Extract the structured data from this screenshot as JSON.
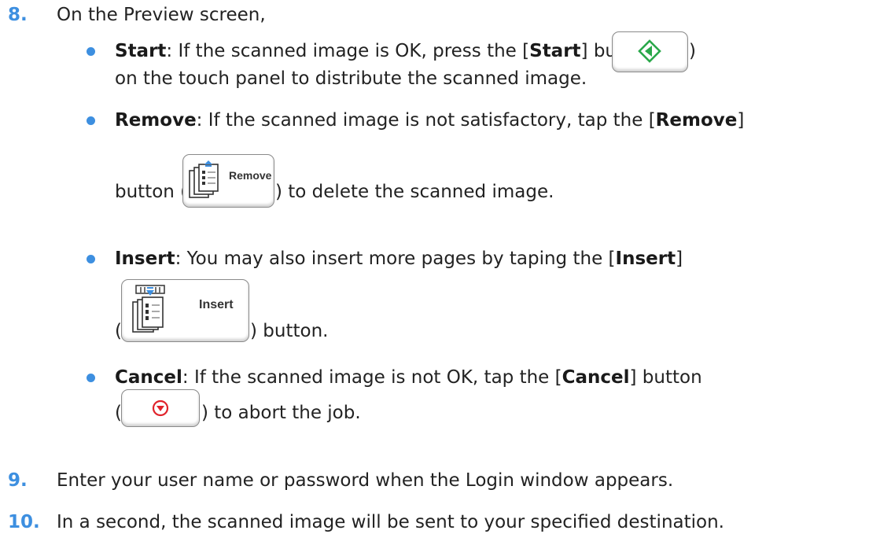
{
  "steps": [
    {
      "number": "8.",
      "text": "On the Preview screen,"
    },
    {
      "number": "9.",
      "text": "Enter your user name or password when the Login window appears."
    },
    {
      "number": "10.",
      "text": "In a second, the scanned image will be sent to your specified destination."
    }
  ],
  "bullets": {
    "start": {
      "term": "Start",
      "line1_a": ": If the scanned image is OK, press the [",
      "line1_b": "Start",
      "line1_c": "] button (",
      "line1_d": ")",
      "line2": "on the touch panel to distribute the scanned image."
    },
    "remove": {
      "term": "Remove",
      "line1_a": ": If the scanned image is not satisfactory, tap the [",
      "line1_b": "Remove",
      "line1_c": "]",
      "line2_a": "button (",
      "line2_b": ") to delete the scanned image.",
      "button_label": "Remove"
    },
    "insert": {
      "term": "Insert",
      "line1_a": ": You may also insert more pages by taping the [",
      "line1_b": "Insert",
      "line1_c": "]",
      "line2_a": "(",
      "line2_b": ") button.",
      "button_label": "Insert"
    },
    "cancel": {
      "term": "Cancel",
      "line1_a": ": If the scanned image is not OK, tap the [",
      "line1_b": "Cancel",
      "line1_c": "] button",
      "line2_a": "(",
      "line2_b": ") to abort the job."
    }
  },
  "icons": {
    "start": "start-diamond-icon",
    "remove": "remove-pages-icon",
    "insert": "insert-pages-icon",
    "cancel": "stop-circle-icon"
  },
  "colors": {
    "step_number": "#3d8fe0",
    "bullet": "#3d8fe0",
    "start_icon": "#2aa84a",
    "cancel_icon": "#e0222a"
  }
}
